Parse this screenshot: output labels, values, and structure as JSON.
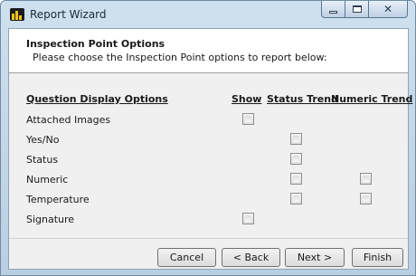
{
  "window": {
    "title": "Report Wizard"
  },
  "header": {
    "title": "Inspection Point Options",
    "subtitle": "Please choose the Inspection Point options to report below:"
  },
  "columns": {
    "options": "Question Display Options",
    "show": "Show",
    "status_trend": "Status Trend",
    "numeric_trend": "Numeric Trend"
  },
  "rows": [
    {
      "label": "Attached Images",
      "show": false,
      "status_trend": null,
      "numeric_trend": null
    },
    {
      "label": "Yes/No",
      "show": null,
      "status_trend": false,
      "numeric_trend": null
    },
    {
      "label": "Status",
      "show": null,
      "status_trend": false,
      "numeric_trend": null
    },
    {
      "label": "Numeric",
      "show": null,
      "status_trend": false,
      "numeric_trend": false
    },
    {
      "label": "Temperature",
      "show": null,
      "status_trend": false,
      "numeric_trend": false
    },
    {
      "label": "Signature",
      "show": false,
      "status_trend": null,
      "numeric_trend": null
    }
  ],
  "buttons": {
    "cancel": "Cancel",
    "back": "< Back",
    "next": "Next >",
    "finish": "Finish"
  },
  "window_buttons": {
    "close_glyph": "✕"
  }
}
